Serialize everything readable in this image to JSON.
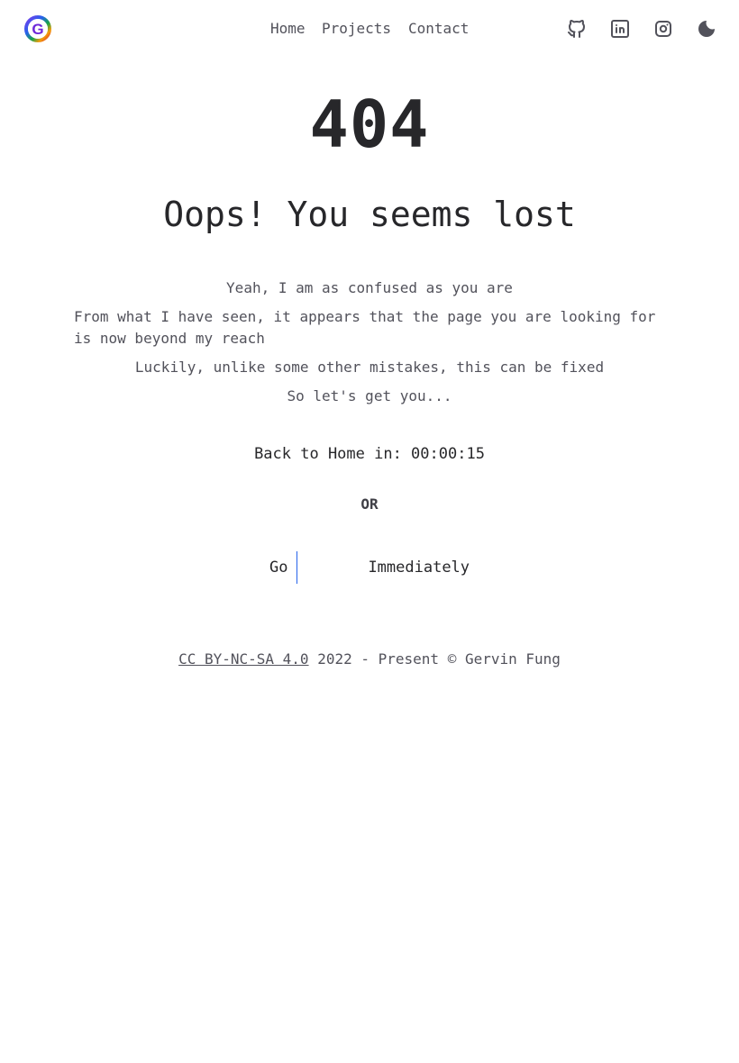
{
  "header": {
    "logo_letter": "G",
    "nav": {
      "home": "Home",
      "projects": "Projects",
      "contact": "Contact"
    },
    "icons": [
      "github-icon",
      "linkedin-icon",
      "instagram-icon",
      "moon-icon"
    ]
  },
  "main": {
    "code": "404",
    "headline": "Oops! You seems lost",
    "paragraphs": [
      "Yeah, I am as confused as you are",
      "From what I have seen, it appears that the page you are looking for is now beyond my reach",
      "Luckily, unlike some other mistakes, this can be fixed",
      "So let's get you..."
    ],
    "countdown": "Back to Home in: 00:00:15",
    "or": "OR",
    "go_word": "Go",
    "go_target": "Immediately"
  },
  "footer": {
    "license_link": "CC BY-NC-SA 4.0",
    "text": " 2022 - Present © Gervin Fung"
  },
  "colors": {
    "text_dark": "#27272a",
    "text_muted": "#52525b",
    "caret": "#2563eb"
  }
}
